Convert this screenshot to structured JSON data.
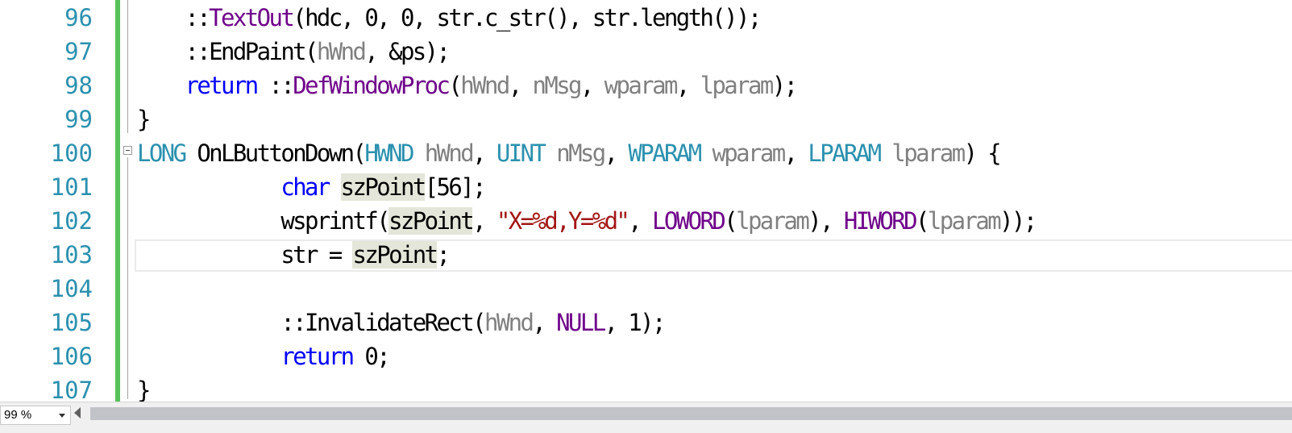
{
  "editor": {
    "lines": [
      {
        "num": "96",
        "tokens": [
          {
            "t": "    ::"
          },
          {
            "t": "TextOut",
            "c": "mac"
          },
          {
            "t": "(hdc, 0, 0, str.c_str(), str.length());"
          }
        ]
      },
      {
        "num": "97",
        "tokens": [
          {
            "t": "    ::EndPaint("
          },
          {
            "t": "hWnd",
            "c": "par"
          },
          {
            "t": ", &ps);"
          }
        ]
      },
      {
        "num": "98",
        "tokens": [
          {
            "t": "    "
          },
          {
            "t": "return",
            "c": "kw"
          },
          {
            "t": " ::"
          },
          {
            "t": "DefWindowProc",
            "c": "mac"
          },
          {
            "t": "("
          },
          {
            "t": "hWnd",
            "c": "par"
          },
          {
            "t": ", "
          },
          {
            "t": "nMsg",
            "c": "par"
          },
          {
            "t": ", "
          },
          {
            "t": "wparam",
            "c": "par"
          },
          {
            "t": ", "
          },
          {
            "t": "lparam",
            "c": "par"
          },
          {
            "t": ");"
          }
        ]
      },
      {
        "num": "99",
        "tokens": [
          {
            "t": "}"
          }
        ]
      },
      {
        "num": "100",
        "tokens": [
          {
            "t": "LONG",
            "c": "ty"
          },
          {
            "t": " OnLButtonDown("
          },
          {
            "t": "HWND",
            "c": "ty"
          },
          {
            "t": " "
          },
          {
            "t": "hWnd",
            "c": "par"
          },
          {
            "t": ", "
          },
          {
            "t": "UINT",
            "c": "ty"
          },
          {
            "t": " "
          },
          {
            "t": "nMsg",
            "c": "par"
          },
          {
            "t": ", "
          },
          {
            "t": "WPARAM",
            "c": "ty"
          },
          {
            "t": " "
          },
          {
            "t": "wparam",
            "c": "par"
          },
          {
            "t": ", "
          },
          {
            "t": "LPARAM",
            "c": "ty"
          },
          {
            "t": " "
          },
          {
            "t": "lparam",
            "c": "par"
          },
          {
            "t": ") {"
          }
        ]
      },
      {
        "num": "101",
        "tokens": [
          {
            "t": "            "
          },
          {
            "t": "char",
            "c": "kw"
          },
          {
            "t": " "
          },
          {
            "t": "szPoint",
            "c": "hl"
          },
          {
            "t": "[56];"
          }
        ]
      },
      {
        "num": "102",
        "tokens": [
          {
            "t": "            wsprintf("
          },
          {
            "t": "szPoint",
            "c": "hl"
          },
          {
            "t": ", "
          },
          {
            "t": "\"X=%d,Y=%d\"",
            "c": "str"
          },
          {
            "t": ", "
          },
          {
            "t": "LOWORD",
            "c": "mac"
          },
          {
            "t": "("
          },
          {
            "t": "lparam",
            "c": "par"
          },
          {
            "t": "), "
          },
          {
            "t": "HIWORD",
            "c": "mac"
          },
          {
            "t": "("
          },
          {
            "t": "lparam",
            "c": "par"
          },
          {
            "t": "));"
          }
        ]
      },
      {
        "num": "103",
        "tokens": [
          {
            "t": "            str = "
          },
          {
            "t": "szPoint",
            "c": "hl"
          },
          {
            "t": ";"
          }
        ]
      },
      {
        "num": "104",
        "tokens": []
      },
      {
        "num": "105",
        "tokens": [
          {
            "t": "            ::InvalidateRect("
          },
          {
            "t": "hWnd",
            "c": "par"
          },
          {
            "t": ", "
          },
          {
            "t": "NULL",
            "c": "mac"
          },
          {
            "t": ", 1);"
          }
        ]
      },
      {
        "num": "106",
        "tokens": [
          {
            "t": "            "
          },
          {
            "t": "return",
            "c": "kw"
          },
          {
            "t": " 0;"
          }
        ]
      },
      {
        "num": "107",
        "tokens": [
          {
            "t": "}"
          }
        ]
      }
    ]
  },
  "status": {
    "zoom": "99 %"
  },
  "colors": {
    "line_number": "#2b91af",
    "keyword": "#0000ff",
    "type": "#2b91af",
    "macro": "#6f008a",
    "parameter": "#808080",
    "string": "#a31515",
    "change_bar": "#57c15a",
    "symbol_highlight": "#e3e6d8"
  }
}
